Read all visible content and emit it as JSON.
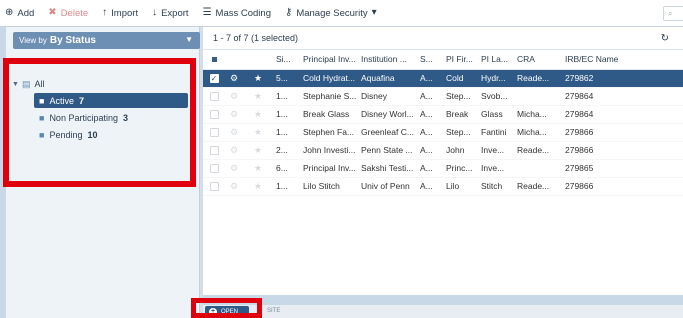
{
  "toolbar": {
    "add": "Add",
    "delete": "Delete",
    "import": "Import",
    "export": "Export",
    "mass_coding": "Mass Coding",
    "manage_security": "Manage Security"
  },
  "sidebar": {
    "view_prefix": "View by",
    "view_value": "By Status",
    "root": "All",
    "items": [
      {
        "label": "Active",
        "count": "7",
        "selected": true
      },
      {
        "label": "Non Participating",
        "count": "3",
        "selected": false
      },
      {
        "label": "Pending",
        "count": "10",
        "selected": false
      }
    ]
  },
  "grid": {
    "summary": "1 - 7 of 7 (1 selected)",
    "columns": [
      "Si...",
      "Principal Inv...",
      "Institution ...",
      "S...",
      "PI Fir...",
      "PI La...",
      "CRA",
      "IRB/EC Name"
    ],
    "rows": [
      {
        "selected": true,
        "cells": [
          "5...",
          "Cold Hydrat...",
          "Aquafina",
          "A...",
          "Cold",
          "Hydr...",
          "Reade...",
          "279862"
        ]
      },
      {
        "selected": false,
        "cells": [
          "1...",
          "Stephanie S...",
          "Disney",
          "A...",
          "Step...",
          "Svob...",
          "",
          "279864"
        ]
      },
      {
        "selected": false,
        "cells": [
          "1...",
          "Break Glass",
          "Disney Worl...",
          "A...",
          "Break",
          "Glass",
          "Micha...",
          "279864"
        ]
      },
      {
        "selected": false,
        "cells": [
          "1...",
          "Stephen Fa...",
          "Greenleaf C...",
          "A...",
          "Step...",
          "Fantini",
          "Micha...",
          "279866"
        ]
      },
      {
        "selected": false,
        "cells": [
          "2...",
          "John Investi...",
          "Penn State ...",
          "A...",
          "John",
          "Inve...",
          "Reade...",
          "279866"
        ]
      },
      {
        "selected": false,
        "cells": [
          "6...",
          "Principal Inv...",
          "Sakshi Testi...",
          "A...",
          "Princ...",
          "Inve...",
          "",
          "279865"
        ]
      },
      {
        "selected": false,
        "cells": [
          "1...",
          "Lilo Stitch",
          "Univ of Penn",
          "A...",
          "Lilo",
          "Stitch",
          "Reade...",
          "279866"
        ]
      }
    ]
  },
  "bottom": {
    "open_label": "OPEN",
    "site_tab": "SITE"
  },
  "colors": {
    "accent": "#2f5a87",
    "highlight_box": "#e0000d",
    "delete_disabled": "#e08a8a"
  }
}
